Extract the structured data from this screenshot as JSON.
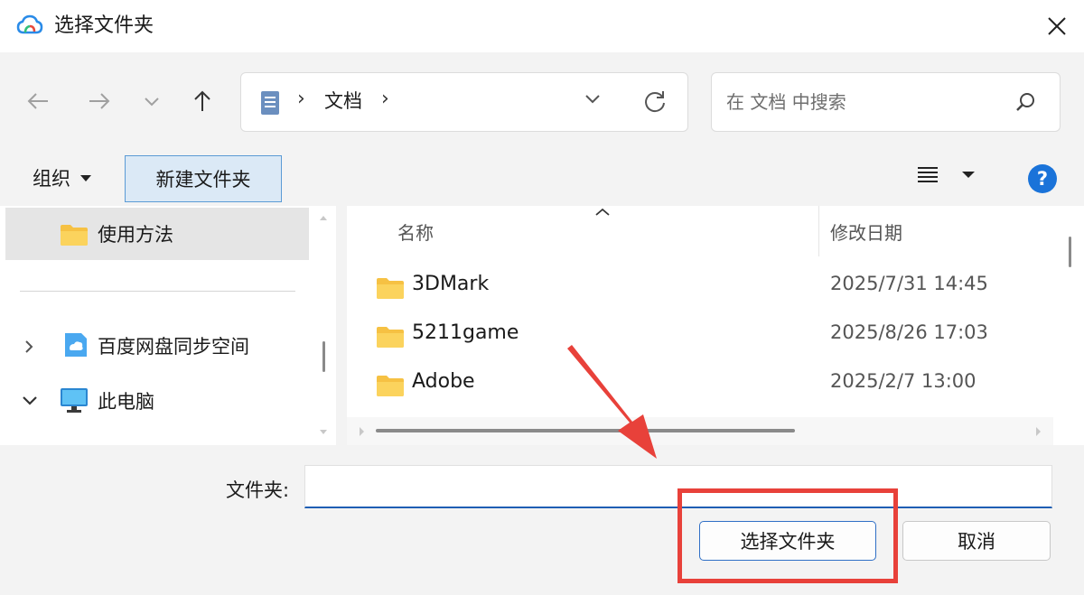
{
  "window": {
    "title": "选择文件夹",
    "close_glyph": "✕"
  },
  "navigation": {
    "address_segment": "文档",
    "search_placeholder": "在 文档 中搜索"
  },
  "commandbar": {
    "organize_label": "组织",
    "new_folder_label": "新建文件夹"
  },
  "nav_pane": {
    "items": [
      {
        "label": "使用方法",
        "icon": "folder-icon",
        "selected": true
      },
      {
        "label": "百度网盘同步空间",
        "icon": "baidu-netdisk-icon",
        "expanded": false
      },
      {
        "label": "此电脑",
        "icon": "computer-icon",
        "expanded": true
      }
    ]
  },
  "file_list": {
    "columns": [
      "名称",
      "修改日期"
    ],
    "rows": [
      {
        "name": "3DMark",
        "modified": "2025/7/31 14:45"
      },
      {
        "name": "5211game",
        "modified": "2025/8/26 17:03"
      },
      {
        "name": "Adobe",
        "modified": "2025/2/7 13:00"
      }
    ]
  },
  "footer": {
    "folder_label": "文件夹:",
    "folder_value": "",
    "select_button": "选择文件夹",
    "cancel_button": "取消"
  },
  "colors": {
    "accent": "#1f5fb4",
    "annotation_red": "#e8413a",
    "folder_yellow": "#f6c143",
    "help_blue": "#1a73d9"
  }
}
